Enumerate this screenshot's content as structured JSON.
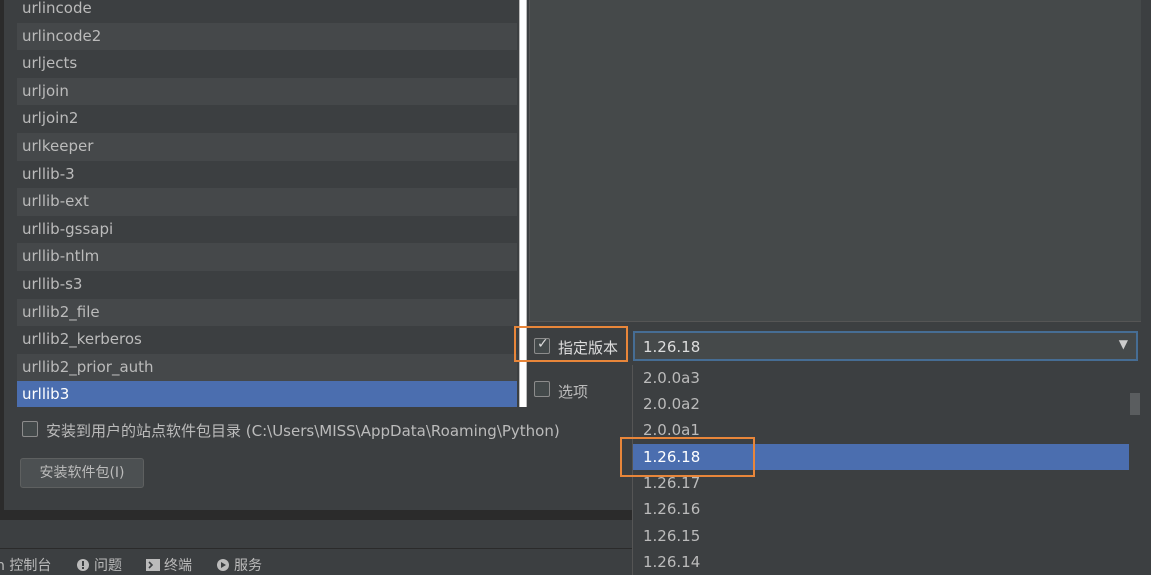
{
  "packages": [
    "urlincode",
    "urlincode2",
    "urljects",
    "urljoin",
    "urljoin2",
    "urlkeeper",
    "urllib-3",
    "urllib-ext",
    "urllib-gssapi",
    "urllib-ntlm",
    "urllib-s3",
    "urllib2_file",
    "urllib2_kerberos",
    "urllib2_prior_auth",
    "urllib3"
  ],
  "selected_package": "urllib3",
  "version": {
    "checkbox_label": "指定版本",
    "checked": true,
    "current_value": "1.26.18",
    "options": [
      "2.0.0a3",
      "2.0.0a2",
      "2.0.0a1",
      "1.26.18",
      "1.26.17",
      "1.26.16",
      "1.26.15",
      "1.26.14"
    ],
    "selected_option": "1.26.18"
  },
  "options_checkbox_label": "选项",
  "user_site_label": "安装到用户的站点软件包目录 (C:\\Users\\MISS\\AppData\\Roaming\\Python)",
  "install_button_label": "安装软件包(I)",
  "bottom_tabs": [
    {
      "label": "n 控制台",
      "icon": "python-console-icon"
    },
    {
      "label": "问题",
      "icon": "problems-icon"
    },
    {
      "label": "终端",
      "icon": "terminal-icon"
    },
    {
      "label": "服务",
      "icon": "services-icon"
    }
  ],
  "colors": {
    "selection": "#4b6eaf",
    "highlight_box": "#e8863a",
    "background": "#3c3f41"
  }
}
